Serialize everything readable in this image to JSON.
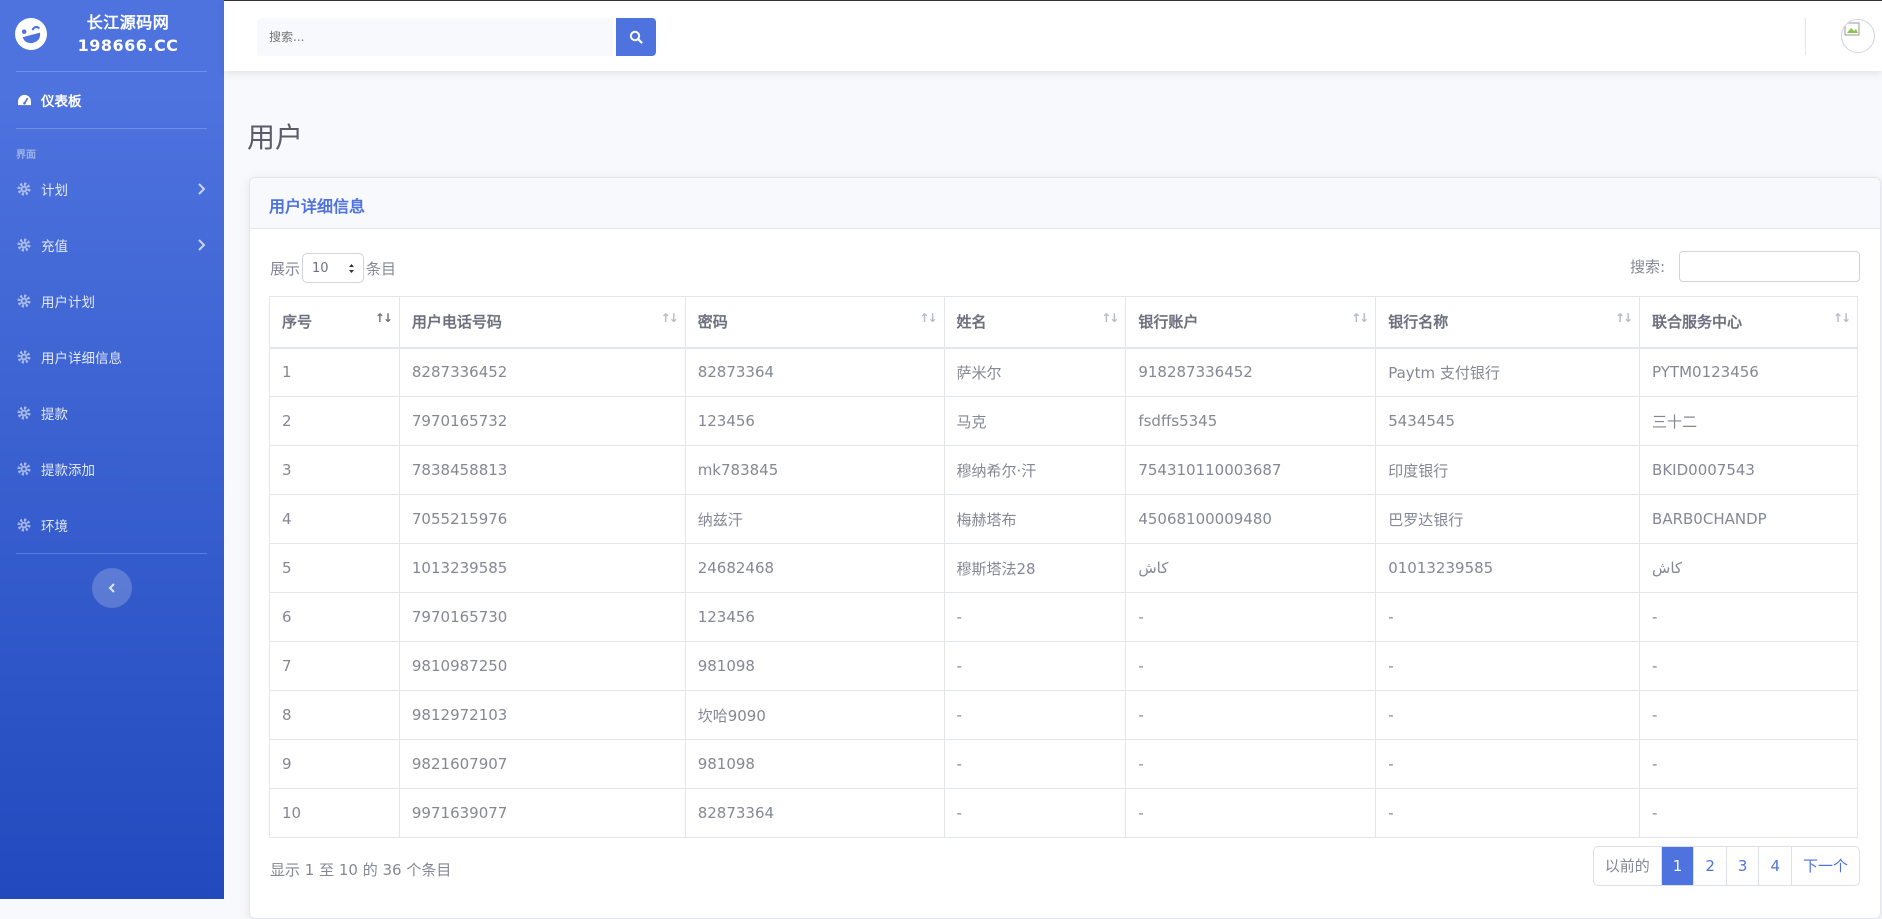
{
  "brand": {
    "line1": "长江源码网",
    "line2": "198666.CC"
  },
  "sidebar": {
    "dashboard": "仪表板",
    "heading": "界面",
    "items": [
      {
        "label": "计划",
        "chevron": true
      },
      {
        "label": "充值",
        "chevron": true
      },
      {
        "label": "用户计划",
        "chevron": false
      },
      {
        "label": "用户详细信息",
        "chevron": false
      },
      {
        "label": "提款",
        "chevron": false
      },
      {
        "label": "提款添加",
        "chevron": false
      },
      {
        "label": "环境",
        "chevron": false
      }
    ]
  },
  "topbar": {
    "search_placeholder": "搜索..."
  },
  "page": {
    "title": "用户"
  },
  "card": {
    "title": "用户详细信息"
  },
  "table_controls": {
    "show_prefix": "展示",
    "length_value": "10",
    "show_suffix": "条目",
    "search_label": "搜索:"
  },
  "table": {
    "columns": [
      "序号",
      "用户电话号码",
      "密码",
      "姓名",
      "银行账户",
      "银行名称",
      "联合服务中心"
    ],
    "rows": [
      [
        "1",
        "8287336452",
        "82873364",
        "萨米尔",
        "918287336452",
        "Paytm 支付银行",
        "PYTM0123456"
      ],
      [
        "2",
        "7970165732",
        "123456",
        "马克",
        "fsdffs5345",
        "5434545",
        "三十二"
      ],
      [
        "3",
        "7838458813",
        "mk783845",
        "穆纳希尔·汗",
        "754310110003687",
        "印度银行",
        "BKID0007543"
      ],
      [
        "4",
        "7055215976",
        "纳兹汗",
        "梅赫塔布",
        "45068100009480",
        "巴罗达银行",
        "BARB0CHANDP"
      ],
      [
        "5",
        "1013239585",
        "24682468",
        "穆斯塔法28",
        "كاش",
        "01013239585",
        "كاش"
      ],
      [
        "6",
        "7970165730",
        "123456",
        "-",
        "-",
        "-",
        "-"
      ],
      [
        "7",
        "9810987250",
        "981098",
        "-",
        "-",
        "-",
        "-"
      ],
      [
        "8",
        "9812972103",
        "坎哈9090",
        "-",
        "-",
        "-",
        "-"
      ],
      [
        "9",
        "9821607907",
        "981098",
        "-",
        "-",
        "-",
        "-"
      ],
      [
        "10",
        "9971639077",
        "82873364",
        "-",
        "-",
        "-",
        "-"
      ]
    ]
  },
  "footer": {
    "info": "显示 1 至 10 的 36 个条目",
    "pagination": {
      "previous": "以前的",
      "pages": [
        "1",
        "2",
        "3",
        "4"
      ],
      "active_page": "1",
      "next": "下一个"
    }
  },
  "colors": {
    "primary": "#4e73df",
    "primary_dark": "#224abe",
    "text": "#858796"
  }
}
